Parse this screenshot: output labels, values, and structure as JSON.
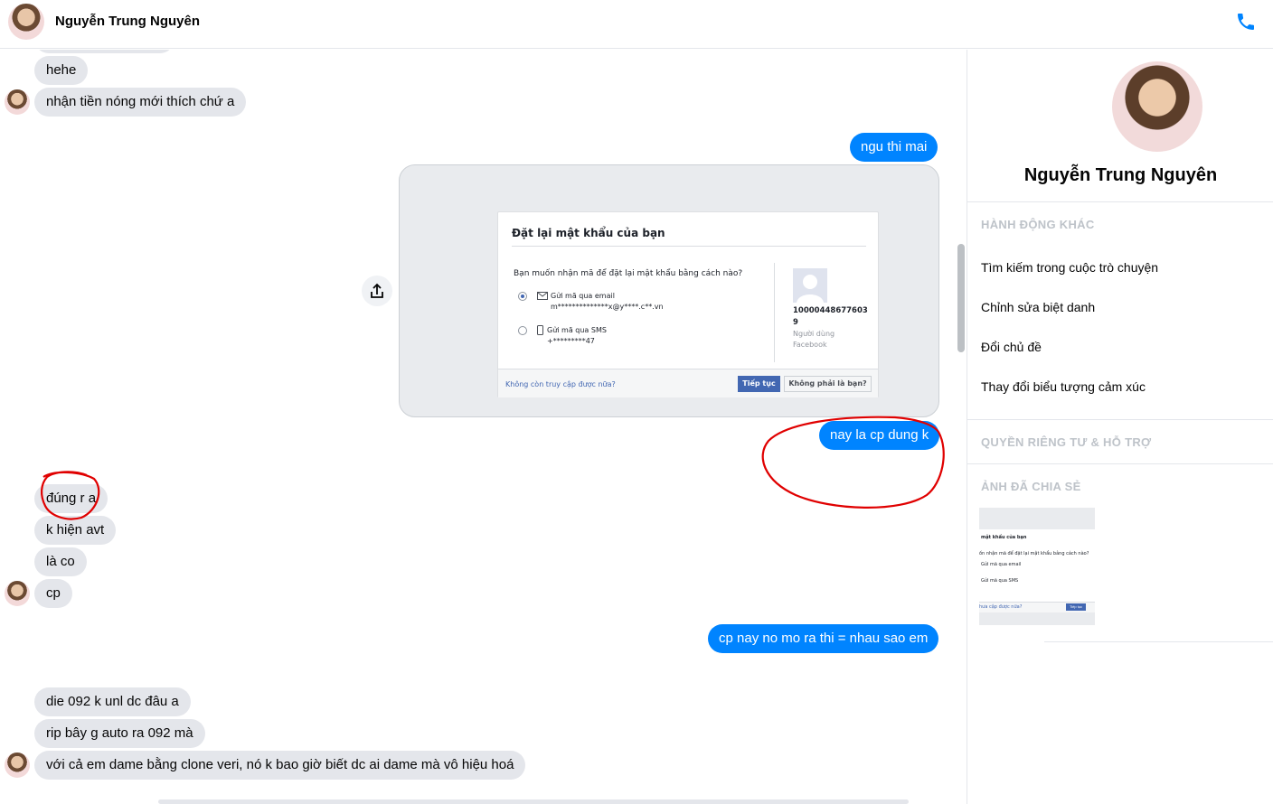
{
  "header": {
    "contact_name": "Nguyễn Trung Nguyên",
    "call_icon": "phone-icon"
  },
  "messages": [
    {
      "side": "in",
      "text": "hehe"
    },
    {
      "side": "in",
      "text": "nhận tiền nóng mới thích chứ a"
    },
    {
      "side": "out",
      "text": "ngu thi mai"
    },
    {
      "side": "out",
      "type": "image"
    },
    {
      "side": "out",
      "text": "nay la cp dung k"
    },
    {
      "side": "in",
      "text": "đúng r a"
    },
    {
      "side": "in",
      "text": "k hiện avt"
    },
    {
      "side": "in",
      "text": "là co"
    },
    {
      "side": "in",
      "text": "cp"
    },
    {
      "side": "out",
      "text": "cp nay no mo ra thi = nhau sao em"
    },
    {
      "side": "in",
      "text": "die 092 k unl dc đâu a"
    },
    {
      "side": "in",
      "text": "rip bây g auto ra 092 mà"
    },
    {
      "side": "in",
      "text": "với cả em dame bằng clone veri, nó k bao giờ biết dc ai dame mà vô hiệu hoá"
    }
  ],
  "reset_card": {
    "title": "Đặt lại mật khẩu của bạn",
    "question": "Bạn muốn nhận mã để đặt lại mật khẩu bằng cách nào?",
    "option_email": "Gửi mã qua email",
    "option_email_value": "m**************x@y****.c**.vn",
    "option_sms": "Gửi mã qua SMS",
    "option_sms_value": "+*********47",
    "user_id": "100004486776039",
    "user_role": "Người dùng Facebook",
    "footer_link": "Không còn truy cập được nữa?",
    "continue_button": "Tiếp tục",
    "not_you_button": "Không phải là bạn?"
  },
  "panel": {
    "name": "Nguyễn Trung Nguyên",
    "section_more_actions": "HÀNH ĐỘNG KHÁC",
    "actions": [
      "Tìm kiếm trong cuộc trò chuyện",
      "Chỉnh sửa biệt danh",
      "Đổi chủ đề",
      "Thay đổi biểu tượng cảm xúc"
    ],
    "section_privacy": "QUYỀN RIÊNG TƯ & HỖ TRỢ",
    "section_shared_photos": "ẢNH ĐÃ CHIA SẺ"
  },
  "shared_thumb": {
    "line1": "mật khẩu của bạn",
    "line2": "ốn nhận mã để đặt lại mật khẩu bằng cách nào?",
    "line3": "Gửi mã qua email",
    "line4": "Gửi mã qua SMS",
    "line5": "hưa cập được nữa?",
    "btn": "Tiếp tục"
  },
  "colors": {
    "outgoing": "#0084ff",
    "incoming": "#e4e6eb",
    "annotation": "#e00000"
  }
}
